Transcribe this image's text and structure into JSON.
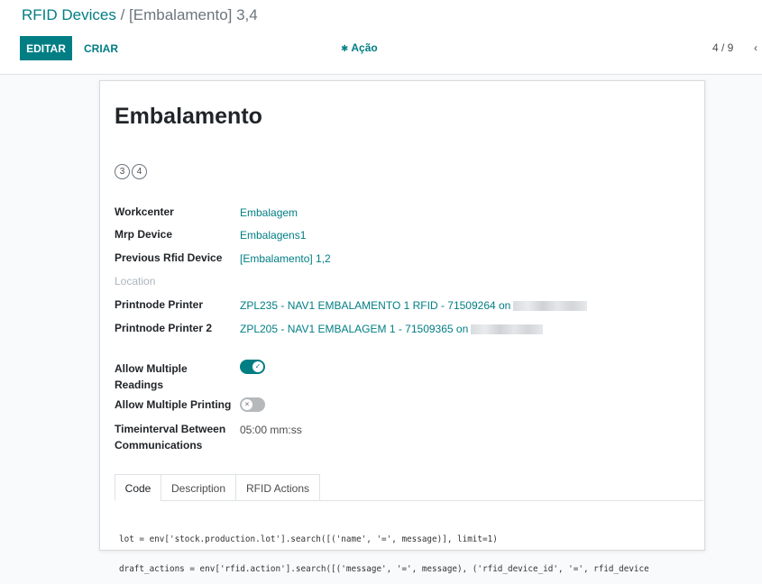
{
  "breadcrumb": {
    "parent": "RFID Devices",
    "separator": " / ",
    "current": "[Embalamento] 3,4"
  },
  "toolbar": {
    "edit_label": "EDITAR",
    "create_label": "CRIAR",
    "action_label": "Ação",
    "action_icon": "gear-icon",
    "pager_value": "4 / 9",
    "pager_prev_icon": "chevron-left-icon",
    "pager_prev_glyph": "‹"
  },
  "record": {
    "title": "Embalamento",
    "badges": [
      "3",
      "4"
    ],
    "workcenter_label": "Workcenter",
    "workcenter_value": "Embalagem",
    "mrp_device_label": "Mrp Device",
    "mrp_device_value": "Embalagens1",
    "prev_device_label": "Previous Rfid Device",
    "prev_device_value": "[Embalamento] 1,2",
    "location_label": "Location",
    "printer_label": "Printnode Printer",
    "printer_value": "ZPL235 - NAV1 EMBALAMENTO 1 RFID - 71509264 on",
    "printer2_label": "Printnode Printer 2",
    "printer2_value": "ZPL205 - NAV1 EMBALAGEM 1 - 71509365 on",
    "allow_multi_read_label_1": "Allow Multiple",
    "allow_multi_read_label_2": "Readings",
    "allow_multi_read_value": true,
    "allow_multi_print_label": "Allow Multiple Printing",
    "allow_multi_print_value": false,
    "time_interval_label_1": "Timeinterval Between",
    "time_interval_label_2": "Communications",
    "time_interval_value": "05:00 mm:ss"
  },
  "tabs": [
    {
      "label": "Code",
      "active": true
    },
    {
      "label": "Description",
      "active": false
    },
    {
      "label": "RFID Actions",
      "active": false
    }
  ],
  "code_lines": [
    "lot = env['stock.production.lot'].search([('name', '=', message)], limit=1)",
    "draft_actions = env['rfid.action'].search([('message', '=', message), ('rfid_device_id', '=', rfid_device"
  ],
  "colors": {
    "accent": "#017e84",
    "toggle_off": "#b6b9bc"
  }
}
